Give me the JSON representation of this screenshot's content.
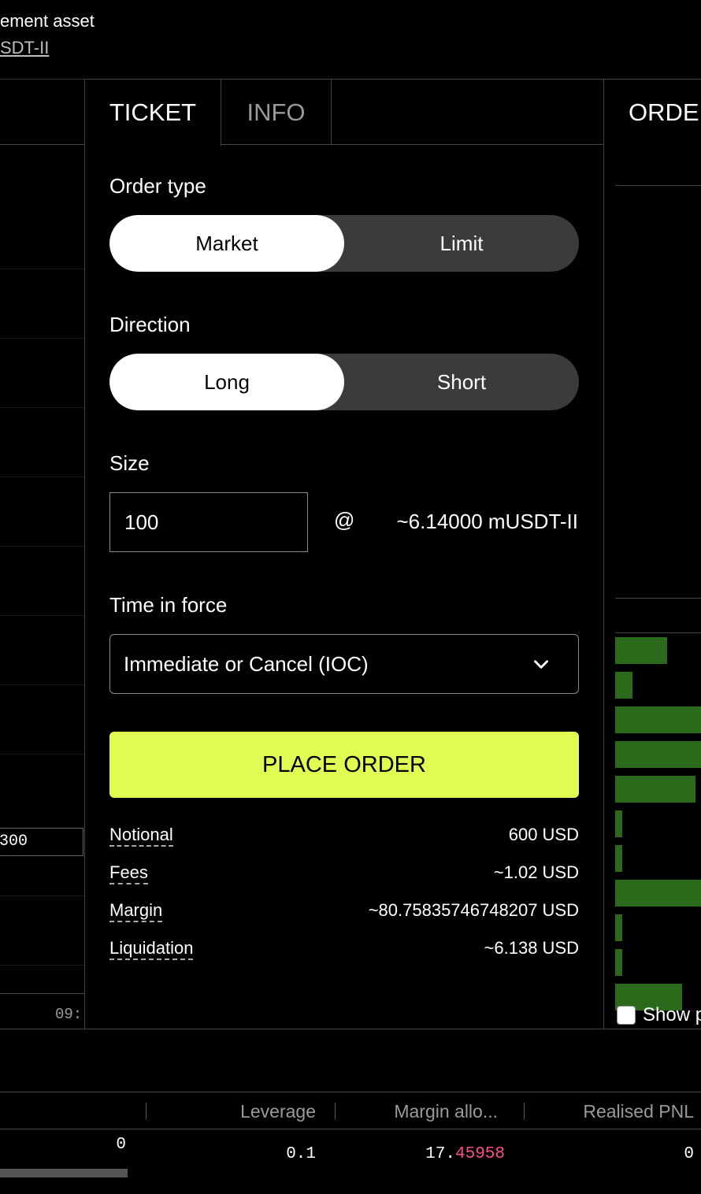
{
  "header": {
    "settlement_label": "ement asset",
    "settlement_link": "SDT-II"
  },
  "chart": {
    "price_label": "300",
    "time_tick": "09:"
  },
  "ticket": {
    "tabs": [
      {
        "label": "TICKET",
        "active": true
      },
      {
        "label": "INFO",
        "active": false
      }
    ],
    "order_type": {
      "label": "Order type",
      "options": [
        "Market",
        "Limit"
      ],
      "selected": "Market"
    },
    "direction": {
      "label": "Direction",
      "options": [
        "Long",
        "Short"
      ],
      "selected": "Long"
    },
    "size": {
      "label": "Size",
      "value": "100",
      "at": "@",
      "price_estimate": "~6.14000 mUSDT-II"
    },
    "time_in_force": {
      "label": "Time in force",
      "selected": "Immediate or Cancel (IOC)"
    },
    "place_order_label": "PLACE ORDER",
    "summary": [
      {
        "key": "Notional",
        "value": "600 USD"
      },
      {
        "key": "Fees",
        "value": "~1.02 USD"
      },
      {
        "key": "Margin",
        "value": "~80.75835746748207 USD"
      },
      {
        "key": "Liquidation",
        "value": "~6.138 USD"
      }
    ]
  },
  "orders": {
    "title": "ORDERBOOK",
    "show_label": "Show prices",
    "depth_fractions": [
      0.6,
      0.2,
      1.0,
      1.0,
      0.93,
      0.08,
      0.08,
      1.0,
      0.08,
      0.08,
      0.77
    ],
    "bar_color": "#2c6a1b"
  },
  "positions": {
    "headers": [
      "Leverage",
      "Margin allo...",
      "Realised PNL"
    ],
    "row": {
      "first": "0",
      "leverage": "0.1",
      "margin_main": "17.",
      "margin_red": "45958",
      "realised_pnl": "0"
    }
  },
  "colors": {
    "accent": "#e2fb52",
    "negative": "#ff4d8d",
    "toggle_bg": "#3b3b3b",
    "border": "#444444"
  }
}
